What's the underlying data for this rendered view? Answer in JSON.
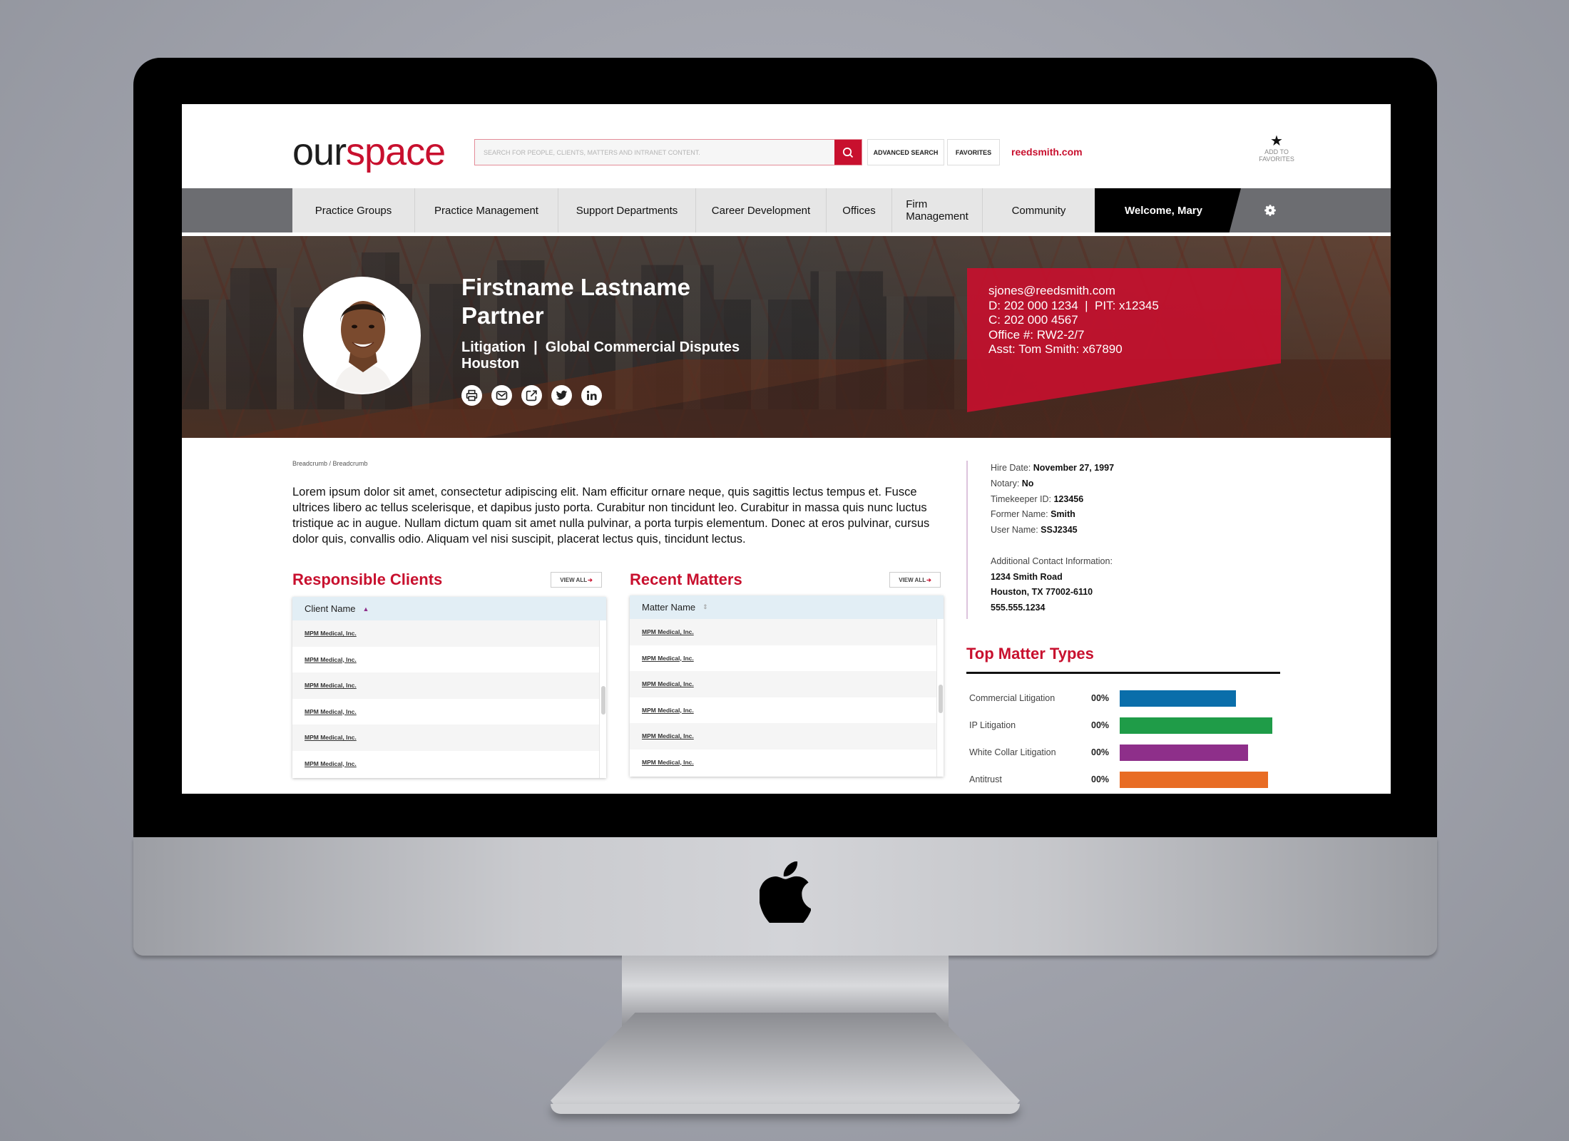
{
  "header": {
    "logo_part1": "our",
    "logo_part2": "space",
    "search_placeholder": "SEARCH FOR PEOPLE, CLIENTS, MATTERS AND INTRANET CONTENT.",
    "advanced_search_label": "ADVANCED SEARCH",
    "favorites_label": "FAVORITES",
    "site_link": "reedsmith.com",
    "add_favorites_line1": "ADD TO",
    "add_favorites_line2": "FAVORITES",
    "star_icon": "★"
  },
  "nav": {
    "items": [
      {
        "label": "Practice Groups"
      },
      {
        "label": "Practice Management"
      },
      {
        "label": "Support Departments"
      },
      {
        "label": "Career Development"
      },
      {
        "label": "Offices"
      },
      {
        "label": "Firm Management"
      },
      {
        "label": "Community"
      }
    ],
    "welcome": "Welcome, Mary",
    "settings_icon": "gear-icon"
  },
  "profile": {
    "name": "Firstname Lastname",
    "title": "Partner",
    "department": "Litigation  |  Global Commercial Disputes",
    "city": "Houston",
    "social_icons": [
      "print-icon",
      "email-icon",
      "share-icon",
      "twitter-icon",
      "linkedin-icon"
    ],
    "contact": {
      "email": "sjones@reedsmith.com",
      "direct": "D: 202 000 1234  |  PIT: x12345",
      "cell": "C: 202 000 4567",
      "office": "Office #: RW2-2/7",
      "assistant": "Asst: Tom Smith: x67890"
    }
  },
  "content": {
    "breadcrumb": "Breadcrumb / Breadcrumb",
    "intro": "Lorem ipsum dolor sit amet, consectetur adipiscing elit. Nam efficitur ornare neque, quis sagittis lectus tempus et. Fusce ultrices libero ac tellus scelerisque, et dapibus justo porta. Curabitur non tincidunt leo. Curabitur in massa quis nunc luctus tristique ac in augue. Nullam dictum quam sit amet nulla pulvinar, a porta turpis elementum. Donec at eros pulvinar, cursus dolor quis, convallis odio. Aliquam vel nisi suscipit, placerat lectus quis, tincidunt lectus."
  },
  "clients": {
    "title": "Responsible Clients",
    "view_all": "VIEW ALL",
    "column": "Client Name",
    "sort": "▲",
    "rows": [
      "MPM Medical, Inc.",
      "MPM Medical, Inc.",
      "MPM Medical, Inc.",
      "MPM Medical, Inc.",
      "MPM Medical, Inc.",
      "MPM Medical, Inc."
    ]
  },
  "matters": {
    "title": "Recent Matters",
    "view_all": "VIEW ALL",
    "column": "Matter Name",
    "sort": "⇕",
    "rows": [
      "MPM Medical, Inc.",
      "MPM Medical, Inc.",
      "MPM Medical, Inc.",
      "MPM Medical, Inc.",
      "MPM Medical, Inc.",
      "MPM Medical, Inc."
    ]
  },
  "details": {
    "hire_label": "Hire Date:",
    "hire_value": "November 27, 1997",
    "notary_label": "Notary:",
    "notary_value": "No",
    "timekeeper_label": "Timekeeper ID:",
    "timekeeper_value": "123456",
    "former_label": "Former Name:",
    "former_value": "Smith",
    "user_label": "User Name:",
    "user_value": "SSJ2345",
    "additional_label": "Additional Contact Information:",
    "address1": "1234 Smith Road",
    "address2": "Houston, TX 77002-6110",
    "phone": "555.555.1234"
  },
  "top_matter_types": {
    "title": "Top Matter Types",
    "items": [
      {
        "label": "Commercial Litigation",
        "pct_text": "00%",
        "fill": 0.76,
        "color": "#0a6eaa"
      },
      {
        "label": "IP Litigation",
        "pct_text": "00%",
        "fill": 1.0,
        "color": "#1f9c48"
      },
      {
        "label": "White Collar Litigation",
        "pct_text": "00%",
        "fill": 0.84,
        "color": "#8e2f8a"
      },
      {
        "label": "Antitrust",
        "pct_text": "00%",
        "fill": 0.97,
        "color": "#e86c24"
      }
    ]
  },
  "colors": {
    "brand_red": "#c8102e",
    "nav_gray": "#6c6d71",
    "nav_light": "#e6e6e6"
  }
}
